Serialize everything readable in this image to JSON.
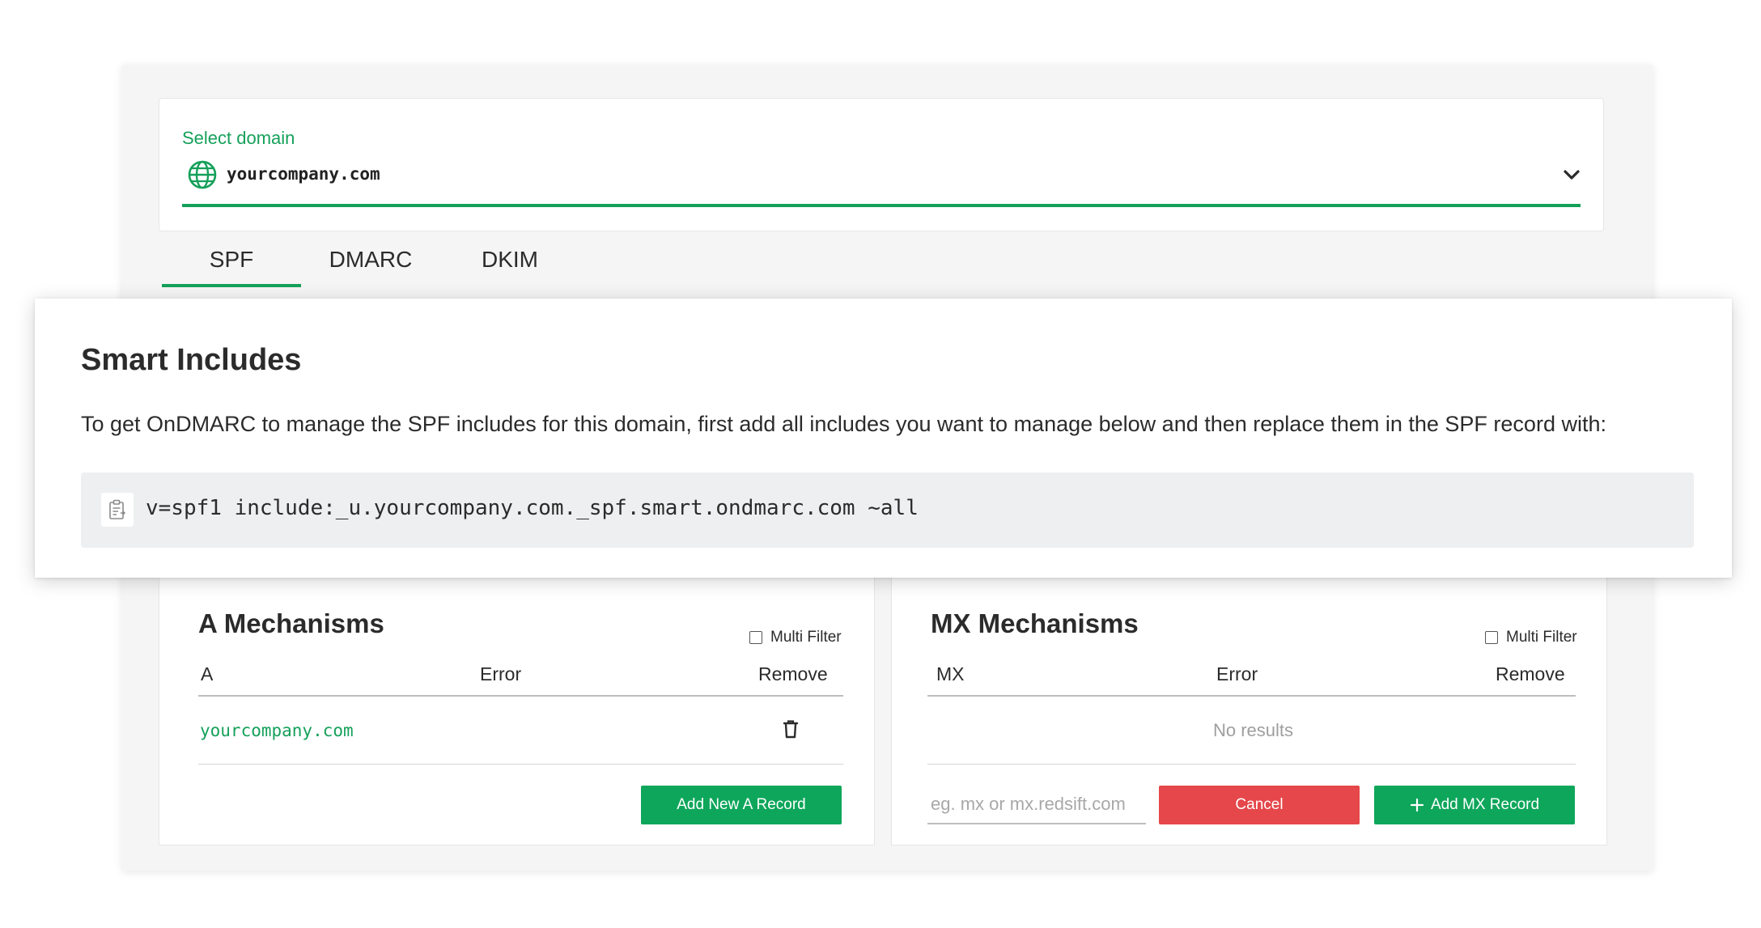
{
  "domain_selector": {
    "label": "Select domain",
    "value": "yourcompany.com"
  },
  "tabs": [
    {
      "label": "SPF",
      "active": true
    },
    {
      "label": "DMARC",
      "active": false
    },
    {
      "label": "DKIM",
      "active": false
    }
  ],
  "smart_includes": {
    "title": "Smart Includes",
    "description": "To get OnDMARC to manage the SPF includes for this domain, first add all includes you want to manage below and then replace them in the SPF record with:",
    "record": "v=spf1 include:_u.yourcompany.com._spf.smart.ondmarc.com ~all"
  },
  "a_mechanisms": {
    "title": "A Mechanisms",
    "multi_filter_label": "Multi Filter",
    "columns": [
      "A",
      "Error",
      "Remove"
    ],
    "rows": [
      {
        "a": "yourcompany.com",
        "error": ""
      }
    ],
    "add_button": "Add New A Record"
  },
  "mx_mechanisms": {
    "title": "MX Mechanisms",
    "multi_filter_label": "Multi Filter",
    "columns": [
      "MX",
      "Error",
      "Remove"
    ],
    "empty_text": "No results",
    "input_placeholder": "eg. mx or mx.redsift.com",
    "cancel_button": "Cancel",
    "add_button": "Add MX Record"
  },
  "colors": {
    "accent": "#15a05a",
    "danger": "#e5474a",
    "panel_bg": "#f5f5f5",
    "code_bg": "#eeeff0"
  },
  "icons": [
    "globe-icon",
    "chevron-down-icon",
    "clipboard-icon",
    "trash-icon",
    "plus-icon"
  ]
}
